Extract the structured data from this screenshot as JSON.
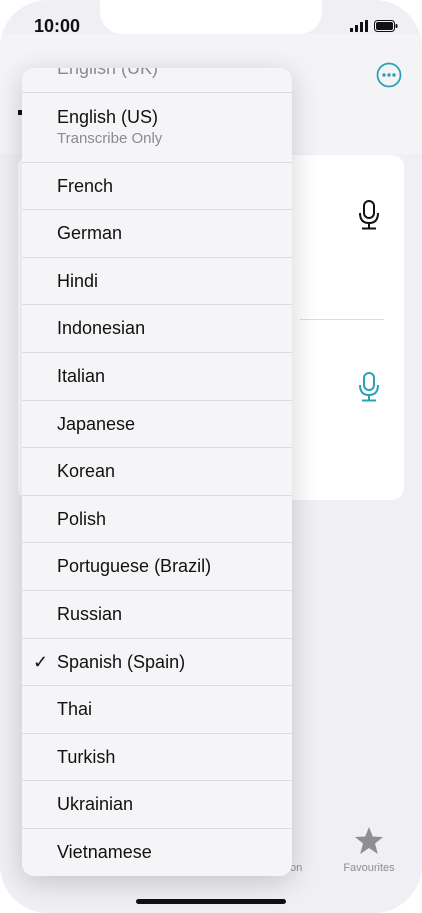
{
  "status_bar": {
    "time": "10:00"
  },
  "language_menu": {
    "items": [
      {
        "label": "English (UK)",
        "subtitle": "",
        "selected": false
      },
      {
        "label": "English (US)",
        "subtitle": "Transcribe Only",
        "selected": false
      },
      {
        "label": "French",
        "subtitle": "",
        "selected": false
      },
      {
        "label": "German",
        "subtitle": "",
        "selected": false
      },
      {
        "label": "Hindi",
        "subtitle": "",
        "selected": false
      },
      {
        "label": "Indonesian",
        "subtitle": "",
        "selected": false
      },
      {
        "label": "Italian",
        "subtitle": "",
        "selected": false
      },
      {
        "label": "Japanese",
        "subtitle": "",
        "selected": false
      },
      {
        "label": "Korean",
        "subtitle": "",
        "selected": false
      },
      {
        "label": "Polish",
        "subtitle": "",
        "selected": false
      },
      {
        "label": "Portuguese (Brazil)",
        "subtitle": "",
        "selected": false
      },
      {
        "label": "Russian",
        "subtitle": "",
        "selected": false
      },
      {
        "label": "Spanish (Spain)",
        "subtitle": "",
        "selected": true
      },
      {
        "label": "Thai",
        "subtitle": "",
        "selected": false
      },
      {
        "label": "Turkish",
        "subtitle": "",
        "selected": false
      },
      {
        "label": "Ukrainian",
        "subtitle": "",
        "selected": false
      },
      {
        "label": "Vietnamese",
        "subtitle": "",
        "selected": false
      }
    ],
    "check_glyph": "✓"
  },
  "tab_bar": {
    "partial_label": "on",
    "favourites_label": "Favourites"
  },
  "colors": {
    "accent": "#2aa3b6",
    "text": "#111111",
    "secondary": "#8a8a90"
  },
  "icons": {
    "more": "ellipsis-circle-icon",
    "mic": "microphone-icon",
    "favourites": "star-icon"
  }
}
